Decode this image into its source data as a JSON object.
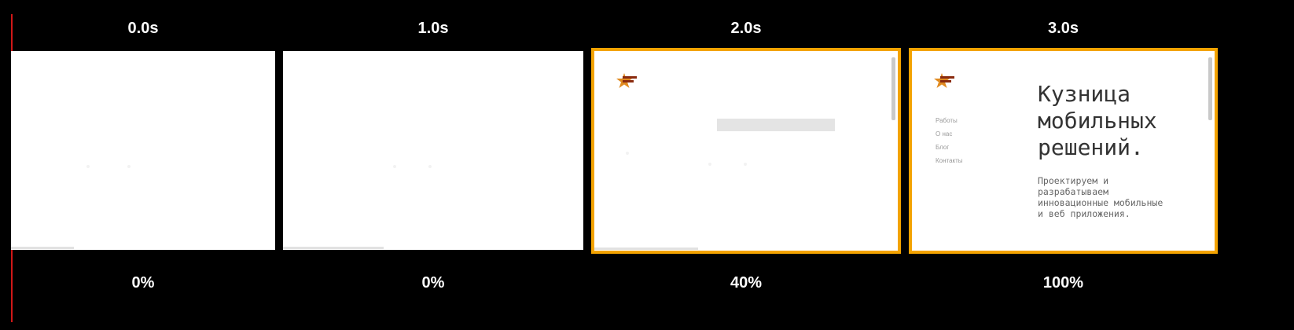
{
  "filmstrip": {
    "frames": [
      {
        "time": "0.0s",
        "progress": "0%",
        "progress_value": 0,
        "highlighted": false
      },
      {
        "time": "1.0s",
        "progress": "0%",
        "progress_value": 0,
        "highlighted": false
      },
      {
        "time": "2.0s",
        "progress": "40%",
        "progress_value": 40,
        "highlighted": true
      },
      {
        "time": "3.0s",
        "progress": "100%",
        "progress_value": 100,
        "highlighted": true
      }
    ],
    "highlight_color": "#f3a300",
    "marker_color": "#d01818"
  },
  "page_preview": {
    "logo_icon": "star-logo-icon",
    "nav": [
      "Работы",
      "О нас",
      "Блог",
      "Контакты"
    ],
    "headline": "Кузница\nмобильных\nрешений.",
    "tagline": "Проектируем и\nразрабатываем\nинновационные мобильные\nи веб приложения."
  }
}
